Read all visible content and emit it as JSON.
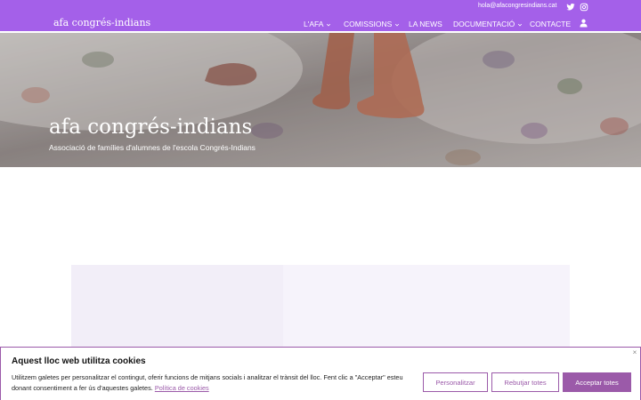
{
  "header": {
    "logo": "afa congrés-indians",
    "email": "hola@afacongresindians.cat",
    "nav": [
      {
        "label": "L'AFA",
        "has_dropdown": true
      },
      {
        "label": "COMISSIONS",
        "has_dropdown": true
      },
      {
        "label": "LA NEWS",
        "has_dropdown": false
      },
      {
        "label": "DOCUMENTACIÓ",
        "has_dropdown": true
      },
      {
        "label": "CONTACTE",
        "has_dropdown": false
      }
    ],
    "social": [
      "twitter-icon",
      "instagram-icon"
    ],
    "accent_color": "#a460e9"
  },
  "hero": {
    "title": "afa congrés-indians",
    "subtitle": "Associació de famílies d'alumnes de l'escola Congrés-Indians"
  },
  "cookie_banner": {
    "title": "Aquest lloc web utilitza cookies",
    "text": "Utilitzem galetes per personalitzar el contingut, oferir funcions de mitjans socials i analitzar el trànsit del lloc. Fent clic a \"Acceptar\" esteu donant consentiment a fer ús d'aquestes galetes.",
    "link": "Política de cookies",
    "buttons": {
      "customize": "Personalitzar",
      "reject": "Rebutjar totes",
      "accept": "Acceptar totes"
    },
    "close": "×",
    "button_color": "#9b5aa9"
  }
}
